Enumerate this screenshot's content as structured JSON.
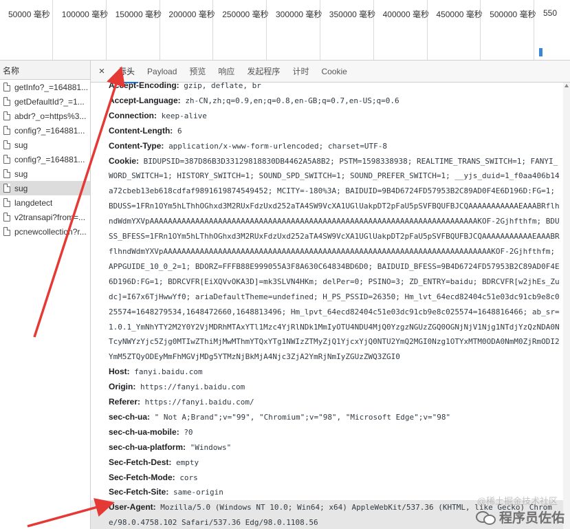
{
  "timeline": {
    "ticks": [
      {
        "label": "50000 毫秒"
      },
      {
        "label": "100000 毫秒"
      },
      {
        "label": "150000 毫秒"
      },
      {
        "label": "200000 毫秒"
      },
      {
        "label": "250000 毫秒"
      },
      {
        "label": "300000 毫秒"
      },
      {
        "label": "350000 毫秒"
      },
      {
        "label": "400000 毫秒"
      },
      {
        "label": "450000 毫秒"
      },
      {
        "label": "500000 毫秒"
      },
      {
        "label": "550"
      }
    ]
  },
  "request_list": {
    "header": "名称",
    "items": [
      {
        "label": "getInfo?_=164881..."
      },
      {
        "label": "getDefaultId?_=1..."
      },
      {
        "label": "abdr?_o=https%3..."
      },
      {
        "label": "config?_=164881..."
      },
      {
        "label": "sug"
      },
      {
        "label": "config?_=164881..."
      },
      {
        "label": "sug"
      },
      {
        "label": "sug",
        "selected": true
      },
      {
        "label": "langdetect"
      },
      {
        "label": "v2transapi?from=..."
      },
      {
        "label": "pcnewcollection?r..."
      }
    ]
  },
  "detail_tabs": {
    "close": "×",
    "items": [
      {
        "label": "标头",
        "active": true
      },
      {
        "label": "Payload"
      },
      {
        "label": "预览"
      },
      {
        "label": "响应"
      },
      {
        "label": "发起程序"
      },
      {
        "label": "计时"
      },
      {
        "label": "Cookie"
      }
    ]
  },
  "request_headers": [
    {
      "name": "Accept-Encoding:",
      "value": "gzip, deflate, br"
    },
    {
      "name": "Accept-Language:",
      "value": "zh-CN,zh;q=0.9,en;q=0.8,en-GB;q=0.7,en-US;q=0.6"
    },
    {
      "name": "Connection:",
      "value": "keep-alive"
    },
    {
      "name": "Content-Length:",
      "value": "6"
    },
    {
      "name": "Content-Type:",
      "value": "application/x-www-form-urlencoded; charset=UTF-8"
    },
    {
      "name": "Cookie:",
      "value": "BIDUPSID=387D86B3D33129818830DB4462A5A8B2; PSTM=1598338938; REALTIME_TRANS_SWITCH=1; FANYI_WORD_SWITCH=1; HISTORY_SWITCH=1; SOUND_SPD_SWITCH=1; SOUND_PREFER_SWITCH=1; __yjs_duid=1_f0aa406b14a72cbeb13eb618cdfaf9891619874549452; MCITY=-180%3A; BAIDUID=9B4D6724FD57953B2C89AD0F4E6D196D:FG=1; BDUSS=1FRn1OYm5hLThhOGhxd3M2RUxFdzUxd252aTA4SW9VcXA1UGlUakpDT2pFaU5pSVFBQUFBJCQAAAAAAAAAAAEAAABRflhndWdmYXVpAAAAAAAAAAAAAAAAAAAAAAAAAAAAAAAAAAAAAAAAAAAAAAAAAAAAAAAAAAAAAAAAAAAAAAAAKOF-2Gjhfthfm; BDUSS_BFESS=1FRn1OYm5hLThhOGhxd3M2RUxFdzUxd252aTA4SW9VcXA1UGlUakpDT2pFaU5pSVFBQUFBJCQAAAAAAAAAAAEAAABRflhndWdmYXVpAAAAAAAAAAAAAAAAAAAAAAAAAAAAAAAAAAAAAAAAAAAAAAAAAAAAAAAAAAAAAAAAAAAAAAAAKOF-2Gjhfthfm; APPGUIDE_10_0_2=1; BDORZ=FFFB88E999055A3F8A630C64834BD6D0; BAIDUID_BFESS=9B4D6724FD57953B2C89AD0F4E6D196D:FG=1; BDRCVFR[EiXQVvOKA3D]=mk3SLVN4HKm; delPer=0; PSINO=3; ZD_ENTRY=baidu; BDRCVFR[w2jhEs_Zudc]=I67x6TjHwwYf0; ariaDefaultTheme=undefined; H_PS_PSSID=26350; Hm_lvt_64ecd82404c51e03dc91cb9e8c025574=1648279534,1648472660,1648813496; Hm_lpvt_64ecd82404c51e03dc91cb9e8c025574=1648816466; ab_sr=1.0.1_YmNhYTY2M2Y0Y2VjMDRhMTAxYTl1Mzc4YjRlNDk1MmIyOTU4NDU4MjQ0YzgzNGUzZGQ0OGNjNjV1Njg1NTdjYzQzNDA0NTcyNWYzYjc5Zjg0MTIwZThiMjMwMThmYTQxYTg1NWIzZTMyZjQ1YjcxYjQ0NTU2YmQ2MGI0Nzg1OTYxMTM0ODA0NmM0ZjRmODI2YmM5ZTQyODEyMmFhMGVjMDg5YTMzNjBkMjA4Njc3ZjA2YmRjNmIyZGUzZWQ3ZGI0"
    },
    {
      "name": "Host:",
      "value": "fanyi.baidu.com"
    },
    {
      "name": "Origin:",
      "value": "https://fanyi.baidu.com"
    },
    {
      "name": "Referer:",
      "value": "https://fanyi.baidu.com/"
    },
    {
      "name": "sec-ch-ua:",
      "value": "\" Not A;Brand\";v=\"99\", \"Chromium\";v=\"98\", \"Microsoft Edge\";v=\"98\""
    },
    {
      "name": "sec-ch-ua-mobile:",
      "value": "?0"
    },
    {
      "name": "sec-ch-ua-platform:",
      "value": "\"Windows\""
    },
    {
      "name": "Sec-Fetch-Dest:",
      "value": "empty"
    },
    {
      "name": "Sec-Fetch-Mode:",
      "value": "cors"
    },
    {
      "name": "Sec-Fetch-Site:",
      "value": "same-origin"
    },
    {
      "name": "User-Agent:",
      "value": "Mozilla/5.0 (Windows NT 10.0; Win64; x64) AppleWebKit/537.36 (KHTML, like Gecko) Chrome/98.0.4758.102 Safari/537.36 Edg/98.0.1108.56",
      "highlight": true
    }
  ],
  "watermark": {
    "text": "程序员佐佑",
    "faint": "@稀土掘金技术社区"
  },
  "colors": {
    "accent": "#1a73e8",
    "arrow": "#e53935"
  }
}
